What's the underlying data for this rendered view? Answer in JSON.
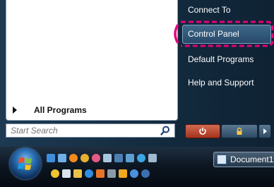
{
  "start_menu": {
    "right_pane": {
      "items": [
        {
          "label": "Connect To"
        },
        {
          "label": "Control Panel"
        },
        {
          "label": "Default Programs"
        },
        {
          "label": "Help and Support"
        }
      ],
      "highlighted": "Control Panel",
      "annotation_color": "#e5007e"
    },
    "left_pane": {
      "all_programs_label": "All Programs"
    },
    "search": {
      "placeholder": "Start Search"
    },
    "buttons": {
      "power_icon": "power-icon",
      "lock_icon": "lock-icon",
      "arrow_icon": "arrow-right-icon"
    }
  },
  "taskbar": {
    "start_orb_icon": "windows-logo-icon",
    "open_window": {
      "label": "Document1"
    }
  }
}
